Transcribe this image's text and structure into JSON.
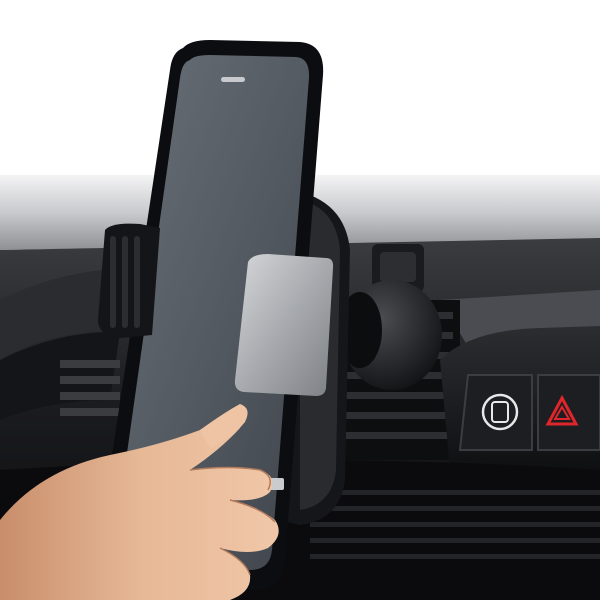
{
  "scene": {
    "subject": "phone-in-car-vent-mount",
    "icons": [
      "car-lock-icon",
      "hazard-warning-icon"
    ]
  },
  "colors": {
    "background": "#ffffff",
    "dashboard": "#1b1c1f",
    "phone_body": "#0c0d10",
    "phone_screen": "#555b63",
    "clamp_silver": "#a7aaae",
    "hazard_red": "#e0262b",
    "skin": "#e0b08f"
  }
}
